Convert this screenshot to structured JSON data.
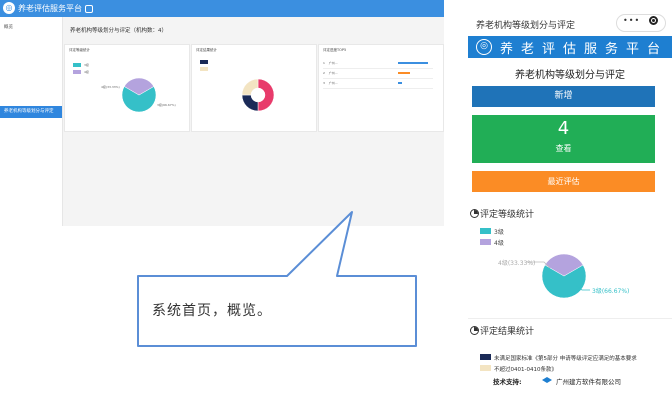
{
  "desktop": {
    "brand": "养老评估服务平台",
    "badge": "",
    "user": "",
    "logout": "",
    "sidebar_items": [
      "概览",
      "",
      "",
      "",
      "",
      "",
      "养老机构等级划分与评定",
      ""
    ],
    "active_index": 6,
    "heading": "养老机构等级划分与评定（机构数：4）",
    "panel1_title": "评定等级统计",
    "panel2_title": "评定结果统计",
    "panel3_title": "评定进度TOP5",
    "level_legend": [
      "3级",
      "4级"
    ],
    "level_labels": [
      "4级(33.33%)",
      "3级(66.67%)"
    ],
    "table_rows": [
      {
        "no": "1",
        "name": "广州..."
      },
      {
        "no": "2",
        "name": "广州..."
      },
      {
        "no": "3",
        "name": "广州..."
      }
    ],
    "colors": {
      "topbar": "#3b8fe0",
      "active": "#2f86de"
    }
  },
  "caption": "系统首页，概览。",
  "mobile": {
    "nav_title": "养老机构等级划分与评定",
    "menu_icon": "more-dots-icon",
    "target_icon": "target-icon",
    "banner_text": "养老评估服务平台",
    "page_title": "养老机构等级划分与评定",
    "buttons": {
      "new": "新增",
      "view_count": "4",
      "view": "查看",
      "recent": "最近评估"
    },
    "level_section_title": "评定等级统计",
    "level_legend": [
      {
        "label": "3级",
        "color": "#35c0c8"
      },
      {
        "label": "4级",
        "color": "#b4a3de"
      }
    ],
    "pie_labels": {
      "left": "4级(33.33%)",
      "right": "3级(66.67%)"
    },
    "result_section_title": "评定结果统计",
    "result_line1": "未满足国家标准《第5部分 申请等级评定应满足的基本要求",
    "result_line2": "不超过0401-0410条款》",
    "footer_label": "技术支持:",
    "footer_company": "广州建方软件有限公司",
    "colors": {
      "banner": "#1e7fd1",
      "new": "#1f73b8",
      "view": "#21ae56",
      "recent": "#fb8c25"
    }
  },
  "chart_data": [
    {
      "type": "pie",
      "title": "评定等级统计",
      "categories": [
        "3级",
        "4级"
      ],
      "values": [
        66.67,
        33.33
      ],
      "colors": [
        "#35c0c8",
        "#b4a3de"
      ]
    },
    {
      "type": "pie",
      "title": "评定结果统计",
      "categories": [
        "",
        "",
        ""
      ],
      "values": [
        50,
        25,
        25
      ],
      "colors": [
        "#e83b6b",
        "#1a2a57",
        "#f3e4c2"
      ]
    }
  ]
}
